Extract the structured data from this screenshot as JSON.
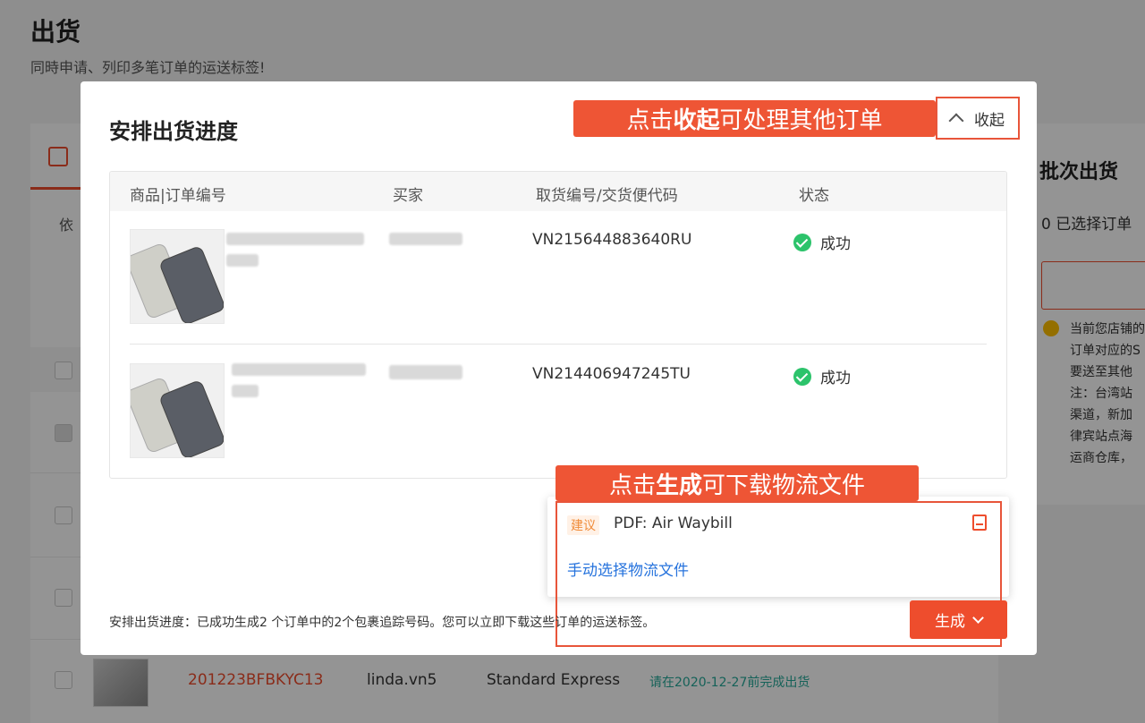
{
  "page": {
    "title": "出货",
    "subtitle": "同時申请、列印多笔订单的运送标签!",
    "filter_label": "依",
    "last_row": {
      "order_id": "201223BFBKYC13",
      "buyer": "linda.vn5",
      "shipping": "Standard Express",
      "deadline": "请在2020-12-27前完成出货"
    }
  },
  "side_panel": {
    "title": "批次出货",
    "selected": "0 已选择订单",
    "notice_lines": [
      "当前您店铺的",
      "订单对应的S",
      "要送至其他",
      "注：台湾站",
      "渠道，新加",
      "律宾站点海",
      "运商仓库，"
    ]
  },
  "modal": {
    "title": "安排出货进度",
    "collapse_label": "收起",
    "annotation_collapse": {
      "pre": "点击",
      "bold": "收起",
      "post": "可处理其他订单"
    },
    "table": {
      "headers": [
        "商品|订单编号",
        "买家",
        "取货编号/交货便代码",
        "状态"
      ],
      "rows": [
        {
          "tracking": "VN215644883640RU",
          "status": "成功"
        },
        {
          "tracking": "VN214406947245TU",
          "status": "成功"
        }
      ]
    },
    "annotation_generate": {
      "pre": "点击",
      "bold": "生成",
      "post": "可下载物流文件"
    },
    "dropdown": {
      "tag": "建议",
      "pdf_option": "PDF: Air Waybill",
      "manual_option": "手动选择物流文件"
    },
    "footer_text": "安排出货进度：已成功生成2 个订单中的2个包裹追踪号码。您可以立即下载这些订单的运送标签。",
    "generate_label": "生成"
  },
  "colors": {
    "accent": "#ee4d2d",
    "success": "#2cc36b",
    "link": "#2673dd",
    "deadline": "#26aa99"
  }
}
